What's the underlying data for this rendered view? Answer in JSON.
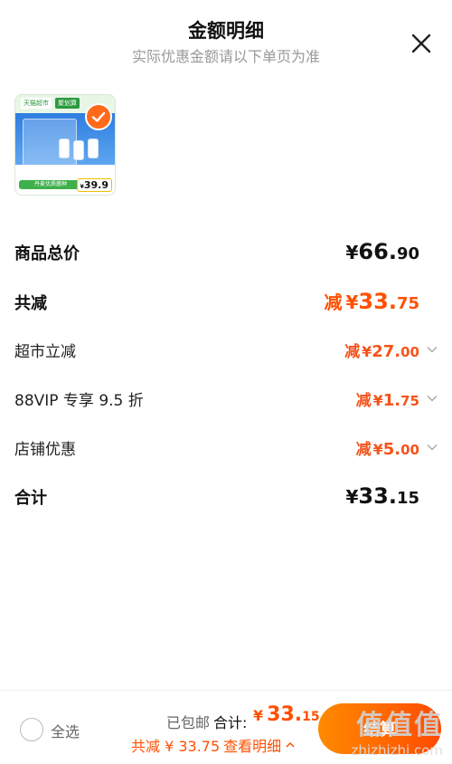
{
  "header": {
    "title": "金额明细",
    "subtitle": "实际优惠金额请以下单页为准"
  },
  "product": {
    "brand_tag_1": "天猫超市",
    "brand_tag_2": "聚划算",
    "promo_bar": "丹麦优质菌种",
    "price_yen": "¥",
    "price": "39.9",
    "selected": true
  },
  "summary": {
    "goods_total_label": "商品总价",
    "goods_total": {
      "yen": "¥",
      "int": "66.",
      "dec": "90"
    },
    "total_discount_label": "共减",
    "total_discount": {
      "prefix": "减",
      "yen": "¥",
      "int": "33.",
      "dec": "75"
    },
    "discounts": [
      {
        "label": "超市立减",
        "prefix": "减",
        "yen": "¥",
        "int": "27.",
        "dec": "00"
      },
      {
        "label": "88VIP 专享 9.5 折",
        "prefix": "减",
        "yen": "¥",
        "int": "1.",
        "dec": "75"
      },
      {
        "label": "店铺优惠",
        "prefix": "减",
        "yen": "¥",
        "int": "5.",
        "dec": "00"
      }
    ],
    "grand_total_label": "合计",
    "grand_total": {
      "yen": "¥",
      "int": "33.",
      "dec": "15"
    }
  },
  "bottom_bar": {
    "select_all": "全选",
    "shipping": "已包邮",
    "total_label": "合计:",
    "total": {
      "yen": "¥",
      "int": "33.",
      "dec": "15"
    },
    "savings_text": "共减 ¥ 33.75",
    "view_details": "查看明细",
    "settle_label": "结算",
    "watermark": "值值值",
    "watermark_url": "zhizhizhi.com"
  },
  "colors": {
    "accent": "#ff5000",
    "discount": "#f5531a",
    "muted": "#999999"
  }
}
